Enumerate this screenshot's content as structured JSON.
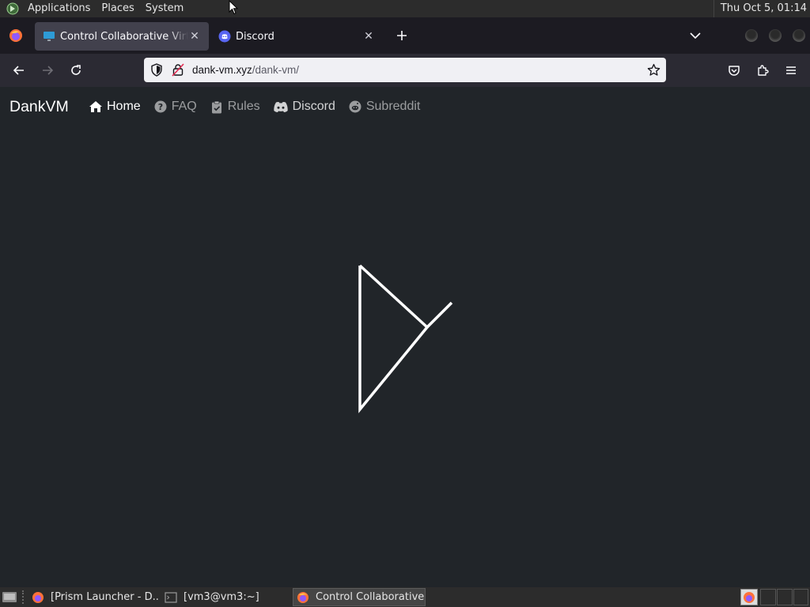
{
  "top_panel": {
    "menus": [
      "Applications",
      "Places",
      "System"
    ],
    "clock": "Thu Oct  5, 01:14",
    "logo_icon": "gnome-foot-icon"
  },
  "browser": {
    "tabs": [
      {
        "title": "Control Collaborative Virtual Machines",
        "icon": "monitor-icon",
        "active": true
      },
      {
        "title": "Discord",
        "icon": "discord-icon",
        "active": false
      }
    ],
    "url_host": "dank-vm.xyz",
    "url_path": "/dank-vm/",
    "accent": "#1c1b22"
  },
  "site": {
    "brand": "DankVM",
    "nav": [
      {
        "label": "Home",
        "icon": "home-icon",
        "active": true
      },
      {
        "label": "FAQ",
        "icon": "question-circle-icon",
        "active": false
      },
      {
        "label": "Rules",
        "icon": "clipboard-check-icon",
        "active": false
      },
      {
        "label": "Discord",
        "icon": "discord-icon",
        "active": false
      },
      {
        "label": "Subreddit",
        "icon": "reddit-icon",
        "active": false
      }
    ],
    "background": "#212529"
  },
  "taskbar": {
    "tasks": [
      {
        "label": "[Prism Launcher - D...",
        "icon": "prism-launcher-icon"
      },
      {
        "label": "[vm3@vm3:~]",
        "icon": "terminal-icon"
      },
      {
        "label": "Control Collaborative...",
        "icon": "firefox-icon",
        "active": true
      }
    ]
  }
}
